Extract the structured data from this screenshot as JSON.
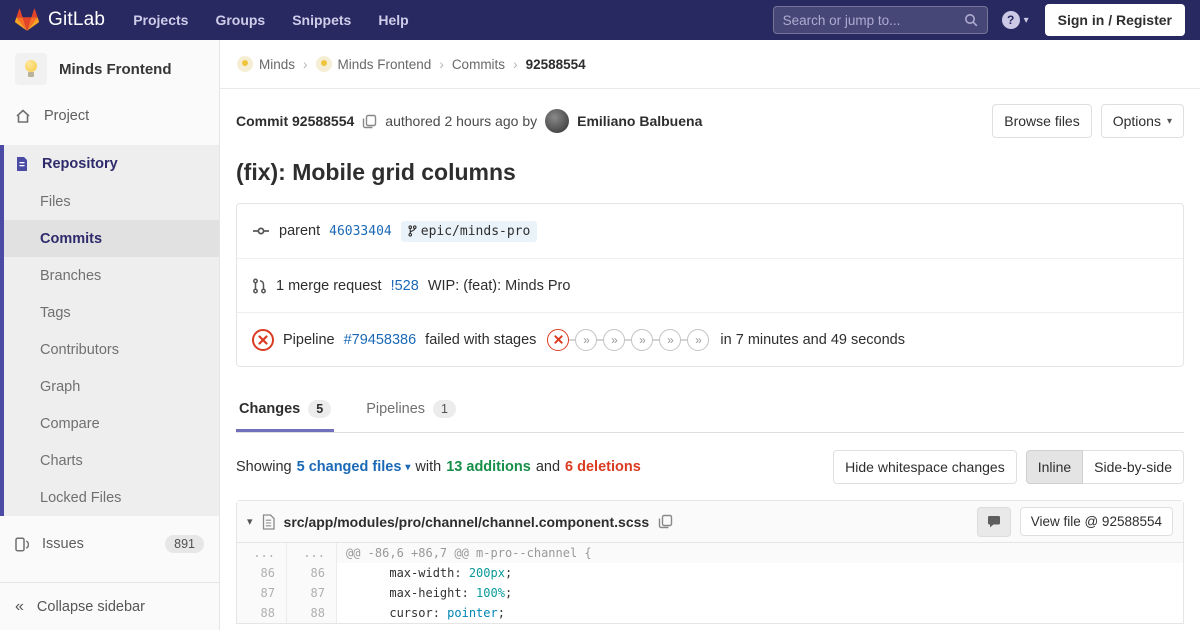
{
  "icons": {
    "skipped_glyph": "»",
    "chevron_down": "▾",
    "collapse_glyph": "«",
    "breadcrumb_sep": "›",
    "help_glyph": "?"
  },
  "colors": {
    "navbar_bg": "#292961",
    "sidebar_accent": "#4b4ba6",
    "tab_accent": "#7070bb",
    "link_blue": "#1b69b6",
    "additions_green": "#168f48",
    "deletions_red": "#db3b21"
  },
  "navbar": {
    "brand": "GitLab",
    "links": [
      {
        "label": "Projects"
      },
      {
        "label": "Groups"
      },
      {
        "label": "Snippets"
      },
      {
        "label": "Help"
      }
    ],
    "search_placeholder": "Search or jump to...",
    "signin_label": "Sign in / Register"
  },
  "sidebar": {
    "project_name": "Minds Frontend",
    "project_item_label": "Project",
    "repository_label": "Repository",
    "repository_items": [
      {
        "label": "Files"
      },
      {
        "label": "Commits"
      },
      {
        "label": "Branches"
      },
      {
        "label": "Tags"
      },
      {
        "label": "Contributors"
      },
      {
        "label": "Graph"
      },
      {
        "label": "Compare"
      },
      {
        "label": "Charts"
      },
      {
        "label": "Locked Files"
      }
    ],
    "issues_label": "Issues",
    "issues_count": "891",
    "collapse_label": "Collapse sidebar"
  },
  "breadcrumb": {
    "items": [
      {
        "label": "Minds"
      },
      {
        "label": "Minds Frontend"
      },
      {
        "label": "Commits"
      }
    ],
    "current": "92588554"
  },
  "commit": {
    "header_label": "Commit 92588554",
    "authored_text": "authored",
    "time_text": "2 hours ago",
    "by_text": "by",
    "author_name": "Emiliano Balbuena",
    "browse_files_label": "Browse files",
    "options_label": "Options",
    "title": "(fix): Mobile grid columns",
    "parent_label": "parent",
    "parent_sha": "46033404",
    "ref_name": "epic/minds-pro",
    "mr_count_text": "1 merge request",
    "mr_id": "!528",
    "mr_title": "WIP: (feat): Minds Pro",
    "pipeline_label": "Pipeline",
    "pipeline_id": "#79458386",
    "pipeline_status_text": "failed with stages",
    "pipeline_stages": [
      "failed",
      "skipped",
      "skipped",
      "skipped",
      "skipped",
      "skipped"
    ],
    "pipeline_duration_text": "in 7 minutes and 49 seconds"
  },
  "tabs": [
    {
      "label": "Changes",
      "count": "5"
    },
    {
      "label": "Pipelines",
      "count": "1"
    }
  ],
  "changes_bar": {
    "showing_text": "Showing",
    "files_link": "5 changed files",
    "with_text": "with",
    "additions_text": "13 additions",
    "and_text": "and",
    "deletions_text": "6 deletions",
    "hide_whitespace_label": "Hide whitespace changes",
    "inline_label": "Inline",
    "side_by_side_label": "Side-by-side"
  },
  "diff": {
    "file_path": "src/app/modules/pro/channel/channel.component.scss",
    "view_file_label": "View file @ 92588554",
    "hunk": {
      "old": "...",
      "new": "...",
      "text": "@@ -86,6 +86,7 @@ m-pro--channel {"
    },
    "lines": [
      {
        "old": "86",
        "new": "86",
        "pre": "      max-width: ",
        "value": "200px",
        "suffix": ";"
      },
      {
        "old": "87",
        "new": "87",
        "pre": "      max-height: ",
        "value": "100%",
        "suffix": ";"
      },
      {
        "old": "88",
        "new": "88",
        "pre": "      cursor: ",
        "value": "pointer",
        "suffix": ";"
      }
    ]
  }
}
